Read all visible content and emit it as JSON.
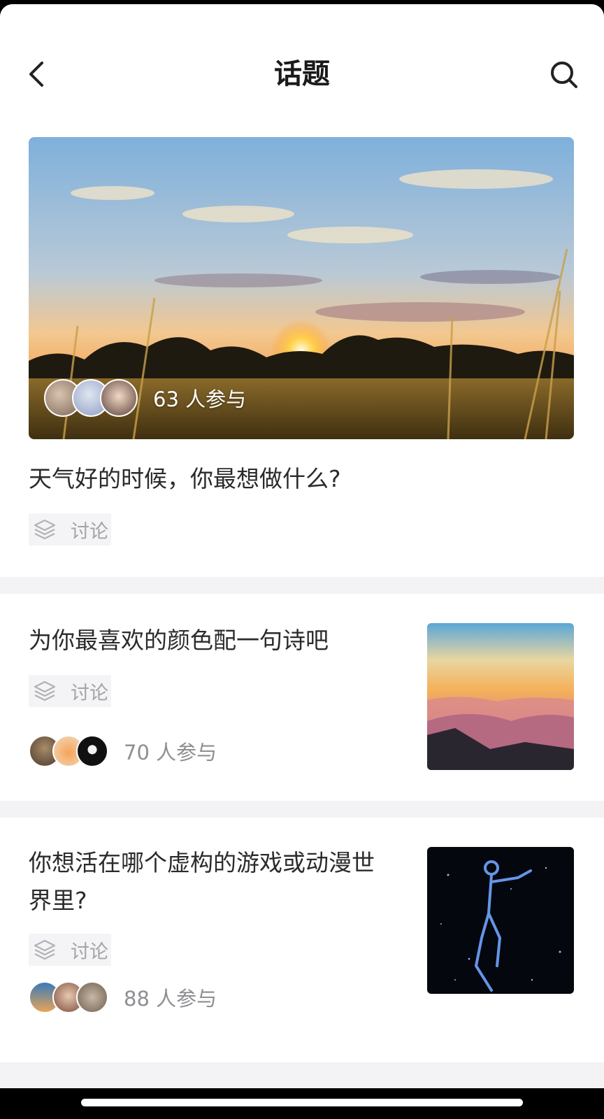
{
  "header": {
    "title": "话题",
    "back_icon": "chevron-left-icon",
    "search_icon": "search-icon"
  },
  "topics": [
    {
      "title": "天气好的时候，你最想做什么?",
      "tag": "讨论",
      "participants": "63 人参与",
      "image": "sunset-field-photo"
    },
    {
      "title": "为你最喜欢的颜色配一句诗吧",
      "tag": "讨论",
      "participants": "70 人参与",
      "image": "mountain-sunset-photo"
    },
    {
      "title_line1": "你想活在哪个虚构的游戏或动漫世",
      "title_line2": "界里?",
      "tag": "讨论",
      "participants": "88 人参与",
      "image": "starry-figure-photo"
    }
  ],
  "colors": {
    "background": "#f3f3f5",
    "card": "#ffffff",
    "text_primary": "#2b2b2b",
    "text_secondary": "#8e8e93",
    "tag_bg": "#f4f4f6"
  }
}
